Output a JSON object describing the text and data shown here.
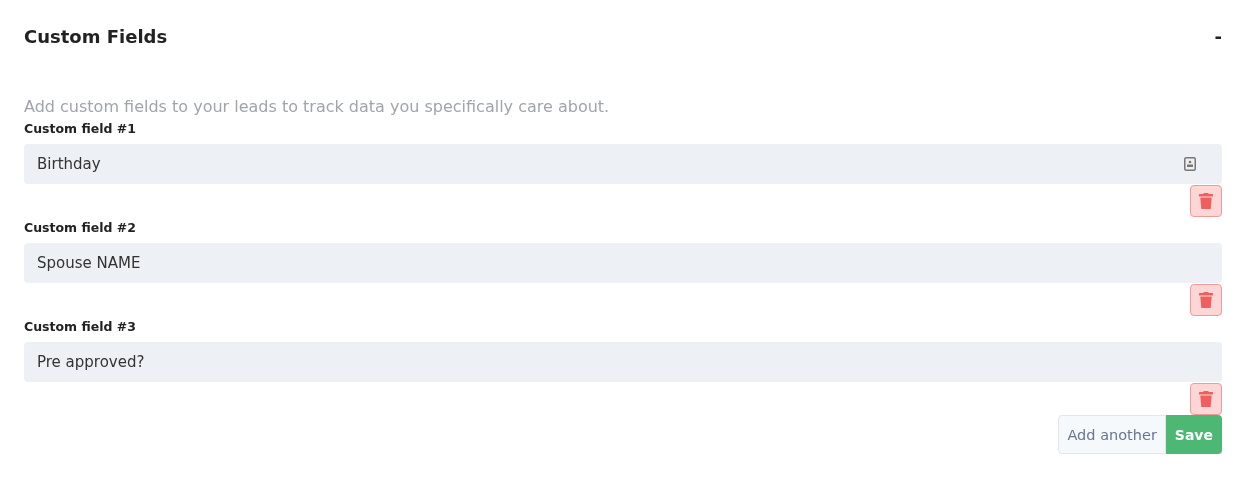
{
  "section": {
    "title": "Custom Fields",
    "collapse_toggle": "-"
  },
  "description": "Add custom fields to your leads to track data you specifically care about.",
  "fields": [
    {
      "label": "Custom field #1",
      "value": "Birthday",
      "autofill_icon": true
    },
    {
      "label": "Custom field #2",
      "value": "Spouse NAME",
      "autofill_icon": false
    },
    {
      "label": "Custom field #3",
      "value": "Pre approved?",
      "autofill_icon": false
    }
  ],
  "buttons": {
    "add": "Add another",
    "save": "Save"
  }
}
